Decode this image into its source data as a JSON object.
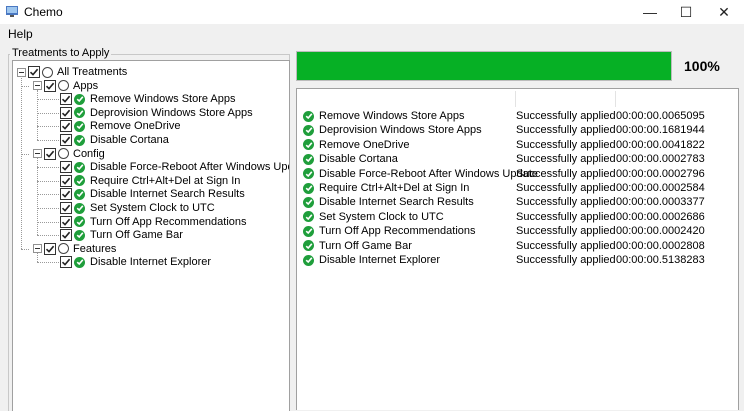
{
  "window": {
    "title": "Chemo",
    "minimize": "—",
    "maximize": "☐",
    "close": "✕"
  },
  "menu": {
    "items": [
      "Help"
    ]
  },
  "treatments": {
    "group_label": "Treatments to Apply",
    "root": {
      "label": "All Treatments"
    },
    "categories": [
      {
        "label": "Apps",
        "items": [
          "Remove Windows Store Apps",
          "Deprovision Windows Store Apps",
          "Remove OneDrive",
          "Disable Cortana"
        ]
      },
      {
        "label": "Config",
        "items": [
          "Disable Force-Reboot After Windows Update",
          "Require Ctrl+Alt+Del at Sign In",
          "Disable Internet Search Results",
          "Set System Clock to UTC",
          "Turn Off App Recommendations",
          "Turn Off Game Bar"
        ]
      },
      {
        "label": "Features",
        "items": [
          "Disable Internet Explorer"
        ]
      }
    ]
  },
  "progress": {
    "value": 1.0,
    "label": "100%"
  },
  "results": [
    {
      "name": "Remove Windows Store Apps",
      "status": "Successfully applied",
      "time": "00:00:00.0065095"
    },
    {
      "name": "Deprovision Windows Store Apps",
      "status": "Successfully applied",
      "time": "00:00:00.1681944"
    },
    {
      "name": "Remove OneDrive",
      "status": "Successfully applied",
      "time": "00:00:00.0041822"
    },
    {
      "name": "Disable Cortana",
      "status": "Successfully applied",
      "time": "00:00:00.0002783"
    },
    {
      "name": "Disable Force-Reboot After Windows Update",
      "status": "Successfully applied",
      "time": "00:00:00.0002796"
    },
    {
      "name": "Require Ctrl+Alt+Del at Sign In",
      "status": "Successfully applied",
      "time": "00:00:00.0002584"
    },
    {
      "name": "Disable Internet Search Results",
      "status": "Successfully applied",
      "time": "00:00:00.0003377"
    },
    {
      "name": "Set System Clock to UTC",
      "status": "Successfully applied",
      "time": "00:00:00.0002686"
    },
    {
      "name": "Turn Off App Recommendations",
      "status": "Successfully applied",
      "time": "00:00:00.0002420"
    },
    {
      "name": "Turn Off Game Bar",
      "status": "Successfully applied",
      "time": "00:00:00.0002808"
    },
    {
      "name": "Disable Internet Explorer",
      "status": "Successfully applied",
      "time": "00:00:00.5138283"
    }
  ],
  "colors": {
    "progress": "#06b025",
    "ok": "#1f9e3b"
  },
  "icons": {
    "success": "green-check-circle-icon",
    "state": "open-circle-icon",
    "app": "chemo-app-icon"
  }
}
